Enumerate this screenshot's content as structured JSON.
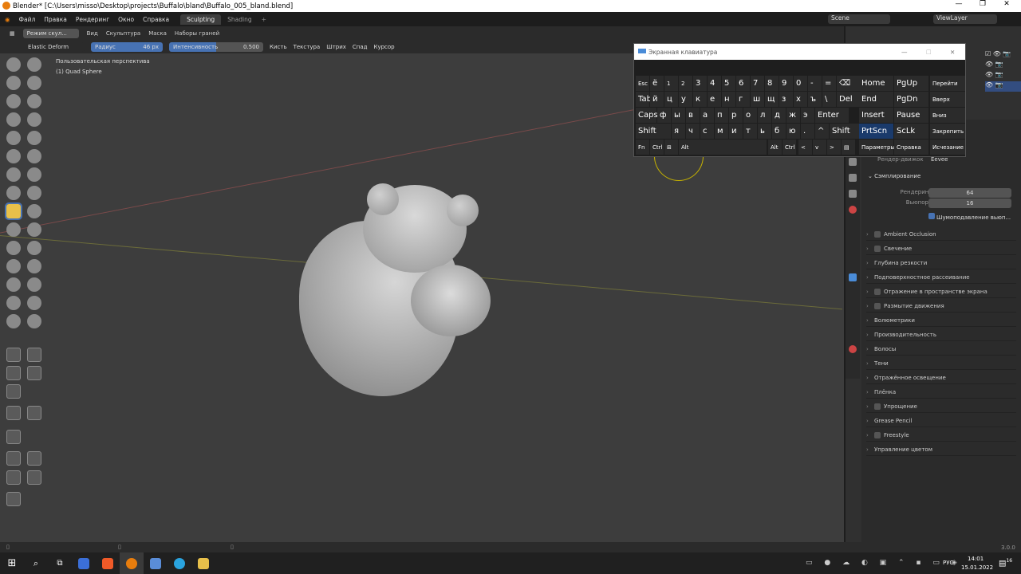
{
  "window": {
    "title": "Blender* [C:\\Users\\misso\\Desktop\\projects\\Buffalo\\bland\\Buffalo_005_bland.blend]"
  },
  "menubar": {
    "items": [
      "Файл",
      "Правка",
      "Рендеринг",
      "Окно",
      "Справка"
    ],
    "tabs": [
      "Sculpting",
      "Shading"
    ],
    "scene": "Scene",
    "viewlayer": "ViewLayer"
  },
  "header": {
    "mode": "Режим скул...",
    "items": [
      "Вид",
      "Скульптура",
      "Маска",
      "Наборы граней"
    ]
  },
  "tool": {
    "brush": "Elastic Deform",
    "radius_label": "Радиус",
    "radius_value": "46 px",
    "strength_label": "Интенсивность",
    "strength_value": "0.500",
    "menus": [
      "Кисть",
      "Текстура",
      "Штрих",
      "Спад",
      "Курсор"
    ]
  },
  "viewport": {
    "perspective": "Пользовательская перспектива",
    "object": "(1) Quad Sphere"
  },
  "osk": {
    "title": "Экранная клавиатура",
    "row1": [
      "Esc",
      "ё",
      "1",
      "2",
      "3",
      "4",
      "5",
      "6",
      "7",
      "8",
      "9",
      "0",
      "-",
      "=",
      "⌫"
    ],
    "row2": [
      "Tab",
      "й",
      "ц",
      "у",
      "к",
      "е",
      "н",
      "г",
      "ш",
      "щ",
      "з",
      "х",
      "ъ",
      "\\",
      "Del"
    ],
    "row3": [
      "Caps",
      "ф",
      "ы",
      "в",
      "а",
      "п",
      "р",
      "о",
      "л",
      "д",
      "ж",
      "э",
      "Enter"
    ],
    "row4": [
      "Shift",
      "я",
      "ч",
      "с",
      "м",
      "и",
      "т",
      "ь",
      "б",
      "ю",
      ".",
      "^",
      "Shift"
    ],
    "row5": [
      "Fn",
      "Ctrl",
      "⊞",
      "Alt",
      "Alt",
      "Ctrl",
      "<",
      "v",
      ">",
      "▤"
    ],
    "nav": [
      "Home",
      "PgUp",
      "End",
      "PgDn",
      "Insert",
      "Pause",
      "PrtScn",
      "ScLk",
      "Параметры",
      "Справка"
    ],
    "side": [
      "Перейти",
      "Вверх",
      "Вниз",
      "Закрепить",
      "Исчезание"
    ]
  },
  "properties": {
    "engine_label": "Рендер-движок",
    "engine_value": "Eevee",
    "sampling": "Сэмплирование",
    "render_label": "Рендеринг",
    "render_value": "64",
    "viewport_label": "Вьюпорт",
    "viewport_value": "16",
    "denoise": "Шумоподавление вьюп...",
    "sections": [
      "Ambient Occlusion",
      "Свечение",
      "Глубина резкости",
      "Подповерхностное рассеивание",
      "Отражение в пространстве экрана",
      "Размытие движения",
      "Волюметрики",
      "Производительность",
      "Волосы",
      "Тени",
      "Отражённое освещение",
      "Плёнка",
      "Упрощение",
      "Grease Pencil",
      "Freestyle",
      "Управление цветом"
    ]
  },
  "statusbar": {
    "version": "3.0.0"
  },
  "taskbar": {
    "lang": "РУС",
    "time": "14:01",
    "date": "15.01.2022",
    "notifications": "16"
  }
}
